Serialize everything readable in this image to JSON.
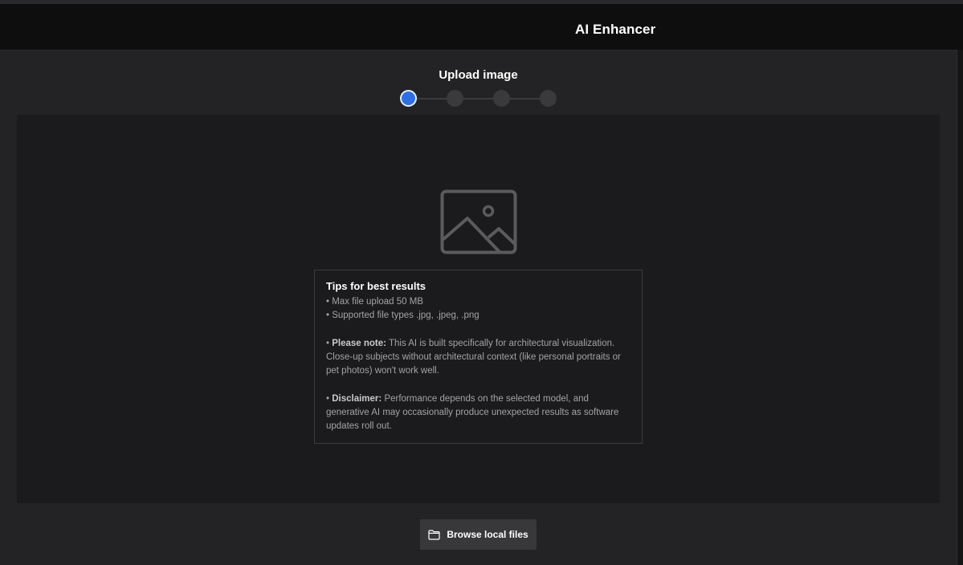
{
  "header": {
    "title": "AI Enhancer"
  },
  "stepper": {
    "title": "Upload image",
    "steps": [
      {
        "state": "active"
      },
      {
        "state": "inactive"
      },
      {
        "state": "inactive"
      },
      {
        "state": "inactive"
      }
    ],
    "active_color": "#2f6fe4"
  },
  "dropzone": {
    "icon": "image-placeholder-icon",
    "tips": {
      "title": "Tips for best results",
      "max_upload": "• Max file upload 50 MB",
      "file_types": "• Supported file types .jpg, .jpeg, .png",
      "note_prefix": "• ",
      "note_label": "Please note:",
      "note_text": " This AI is built specifically for architectural visualization. Close-up subjects without architectural context (like personal portraits or pet photos) won't work well.",
      "disclaimer_prefix": "• ",
      "disclaimer_label": "Disclaimer:",
      "disclaimer_text": " Performance depends on the selected model, and generative AI may occasionally produce unexpected results as software updates roll out."
    }
  },
  "actions": {
    "browse_label": "Browse local files",
    "browse_icon": "folder-icon"
  }
}
